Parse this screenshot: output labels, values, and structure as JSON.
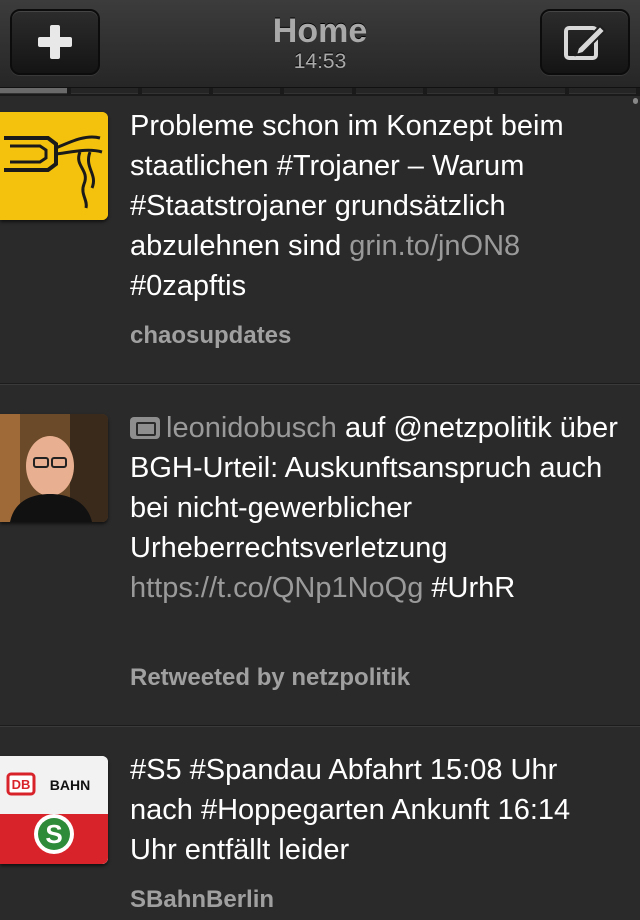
{
  "header": {
    "title": "Home",
    "time": "14:53",
    "left_button_icon": "plus-icon",
    "right_button_icon": "compose-icon"
  },
  "tweets": [
    {
      "text_main": "Probleme schon im Konzept beim staatlichen #Trojaner – Warum #Staatstrojaner grundsätzlich abzulehnen sind ",
      "link": "grin.to/jnON8",
      "text_after": " #0zapftis",
      "author": "chaosupdates",
      "avatar_icon": "chaos-computer-club-logo",
      "avatar_color": "#f4c20d"
    },
    {
      "retweet_user": "leonidobusch",
      "text_main": " auf @netzpolitik über BGH-Urteil: Auskunftsanspruch auch bei nicht-gewerblicher Urheberrechtsverletzung ",
      "link": "https://t.co/QNp1NoQg",
      "text_after": " #UrhR",
      "author": "Retweeted by netzpolitik",
      "avatar_icon": "person-photo"
    },
    {
      "text_main": "#S5 #Spandau Abfahrt 15:08 Uhr nach #Hoppegarten Ankunft 16:14 Uhr entfällt leider",
      "author": "SBahnBerlin",
      "avatar_icon": "db-bahn-s-bahn-logo",
      "avatar_brand_text": "DB",
      "avatar_label": "BAHN",
      "avatar_badge": "S"
    }
  ]
}
